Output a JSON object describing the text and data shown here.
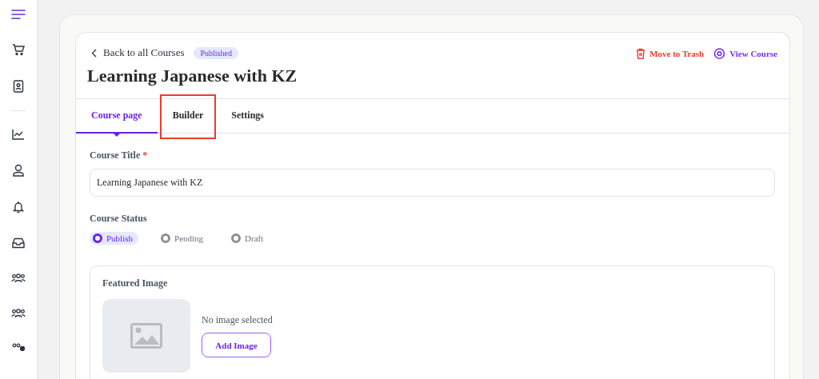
{
  "header": {
    "back_link": "Back to all Courses",
    "status_badge": "Published",
    "title": "Learning Japanese with KZ",
    "actions": [
      {
        "kind": "trash",
        "label": "Move to Trash"
      },
      {
        "kind": "view",
        "label": "View Course"
      }
    ]
  },
  "tabs": [
    {
      "label": "Course page",
      "selected": true,
      "highlighted": false
    },
    {
      "label": "Builder",
      "selected": false,
      "highlighted": true
    },
    {
      "label": "Settings",
      "selected": false,
      "highlighted": false
    }
  ],
  "course_title": {
    "label": "Course Title",
    "required_mark": "*",
    "value": "Learning Japanese with KZ"
  },
  "course_status": {
    "label": "Course Status",
    "options": [
      {
        "label": "Publish",
        "selected": true
      },
      {
        "label": "Pending",
        "selected": false
      },
      {
        "label": "Draft",
        "selected": false
      }
    ]
  },
  "featured_image": {
    "label": "Featured Image",
    "empty_text": "No image selected",
    "button": "Add Image"
  }
}
